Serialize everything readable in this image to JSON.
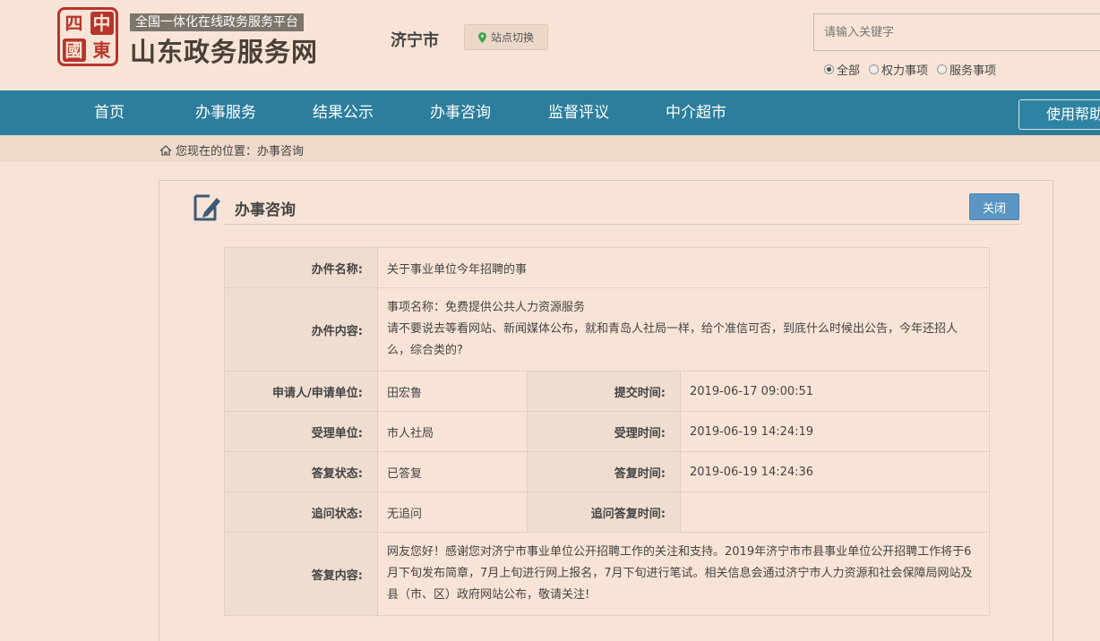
{
  "header": {
    "logo_chars": [
      "四",
      "中",
      "國",
      "東"
    ],
    "tagline": "全国一体化在线政务服务平台",
    "site_title": "山东政务服务网",
    "city": "济宁市",
    "station_switch": "站点切换",
    "search_placeholder": "请输入关键字",
    "search_scopes": [
      {
        "label": "全部",
        "selected": true
      },
      {
        "label": "权力事项",
        "selected": false
      },
      {
        "label": "服务事项",
        "selected": false
      }
    ]
  },
  "nav": {
    "items": [
      "首页",
      "办事服务",
      "结果公示",
      "办事咨询",
      "监督评议",
      "中介超市"
    ],
    "help": "使用帮助"
  },
  "breadcrumb": "您现在的位置：办事咨询",
  "panel": {
    "title": "办事咨询",
    "close_label": "关闭"
  },
  "details": {
    "name_label": "办件名称:",
    "name_value": "关于事业单位今年招聘的事",
    "content_label": "办件内容:",
    "content_item": "事项名称：免费提供公共人力资源服务",
    "content_text": "请不要说去等看网站、新闻媒体公布，就和青岛人社局一样，给个准信可否，到底什么时候出公告，今年还招人么，综合类的?",
    "applicant_label": "申请人/申请单位:",
    "applicant_value": "田宏鲁",
    "submit_time_label": "提交时间:",
    "submit_time_value": "2019-06-17 09:00:51",
    "dept_label": "受理单位:",
    "dept_value": "市人社局",
    "accept_time_label": "受理时间:",
    "accept_time_value": "2019-06-19 14:24:19",
    "reply_status_label": "答复状态:",
    "reply_status_value": "已答复",
    "reply_time_label": "答复时间:",
    "reply_time_value": "2019-06-19 14:24:36",
    "followup_status_label": "追问状态:",
    "followup_status_value": "无追问",
    "followup_reply_time_label": "追问答复时间:",
    "followup_reply_time_value": "",
    "reply_content_label": "答复内容:",
    "reply_content_value": "网友您好！感谢您对济宁市事业单位公开招聘工作的关注和支持。2019年济宁市市县事业单位公开招聘工作将于6月下旬发布简章，7月上旬进行网上报名，7月下旬进行笔试。相关信息会通过济宁市人力资源和社会保障局网站及县（市、区）政府网站公布，敬请关注!"
  }
}
